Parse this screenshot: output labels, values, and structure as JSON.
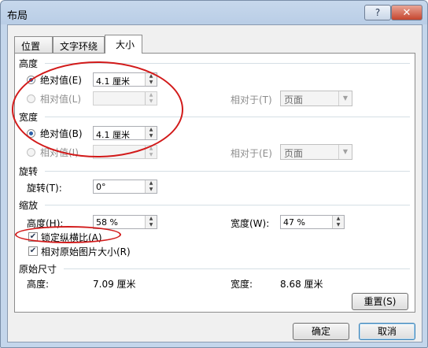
{
  "window": {
    "title": "布局",
    "help_label": "?",
    "close_label": "✕"
  },
  "tabs": [
    {
      "label": "位置"
    },
    {
      "label": "文字环绕"
    },
    {
      "label": "大小"
    }
  ],
  "height": {
    "section_label": "高度",
    "absolute_label": "绝对值(E)",
    "absolute_value": "4.1 厘米",
    "relative_label": "相对值(L)",
    "relative_value": "",
    "relative_to_label": "相对于(T)",
    "relative_to_value": "页面"
  },
  "width": {
    "section_label": "宽度",
    "absolute_label": "绝对值(B)",
    "absolute_value": "4.1 厘米",
    "relative_label": "相对值(I)",
    "relative_value": "",
    "relative_to_label": "相对于(E)",
    "relative_to_value": "页面"
  },
  "rotation": {
    "section_label": "旋转",
    "rotate_label": "旋转(T):",
    "rotate_value": "0°"
  },
  "scale": {
    "section_label": "缩放",
    "height_label": "高度(H):",
    "height_value": "58 %",
    "width_label": "宽度(W):",
    "width_value": "47 %",
    "lock_aspect_label": "锁定纵横比(A)",
    "lock_aspect_checked": true,
    "relative_original_label": "相对原始图片大小(R)",
    "relative_original_checked": true
  },
  "original_size": {
    "section_label": "原始尺寸",
    "height_label": "高度:",
    "height_value": "7.09 厘米",
    "width_label": "宽度:",
    "width_value": "8.68 厘米"
  },
  "buttons": {
    "reset_label": "重置(S)",
    "ok_label": "确定",
    "cancel_label": "取消"
  },
  "annotation_color": "#d21a1a"
}
